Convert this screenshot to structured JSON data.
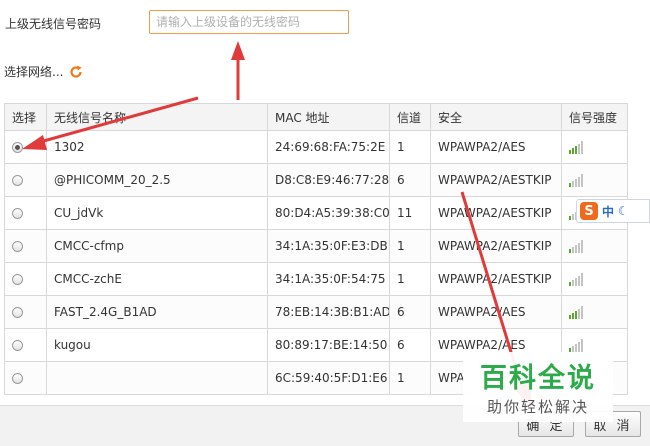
{
  "password": {
    "label": "上级无线信号密码",
    "placeholder": "请输入上级设备的无线密码",
    "value": ""
  },
  "select_network": {
    "label": "选择网络...",
    "refresh_icon": "refresh-icon"
  },
  "table": {
    "columns": [
      "选择",
      "无线信号名称",
      "MAC 地址",
      "信道",
      "安全",
      "信号强度"
    ],
    "rows": [
      {
        "selected": true,
        "ssid": "1302",
        "mac": "24:69:68:FA:75:2E",
        "channel": "1",
        "security": "WPAWPA2/AES",
        "signal_bars": 3
      },
      {
        "selected": false,
        "ssid": "@PHICOMM_20_2.5",
        "mac": "D8:C8:E9:46:77:28",
        "channel": "6",
        "security": "WPAWPA2/AESTKIP",
        "signal_bars": 1
      },
      {
        "selected": false,
        "ssid": "CU_jdVk",
        "mac": "80:D4:A5:39:38:C0",
        "channel": "11",
        "security": "WPAWPA2/AESTKIP",
        "signal_bars": 1
      },
      {
        "selected": false,
        "ssid": "CMCC-cfmp",
        "mac": "34:1A:35:0F:E3:DB",
        "channel": "1",
        "security": "WPAWPA2/AESTKIP",
        "signal_bars": 1
      },
      {
        "selected": false,
        "ssid": "CMCC-zchE",
        "mac": "34:1A:35:0F:54:75",
        "channel": "1",
        "security": "WPAWPA2/AESTKIP",
        "signal_bars": 1
      },
      {
        "selected": false,
        "ssid": "FAST_2.4G_B1AD",
        "mac": "78:EB:14:3B:B1:AD",
        "channel": "6",
        "security": "WPAWPA2/AES",
        "signal_bars": 3
      },
      {
        "selected": false,
        "ssid": "kugou",
        "mac": "80:89:17:BE:14:50",
        "channel": "6",
        "security": "WPAWPA2/AES",
        "signal_bars": 1
      },
      {
        "selected": false,
        "ssid": "",
        "mac": "6C:59:40:5F:D1:E6",
        "channel": "1",
        "security": "WPA",
        "signal_bars": 1
      }
    ]
  },
  "buttons": {
    "ok": "确 定",
    "cancel": "取 消"
  },
  "ime": {
    "logo": "S",
    "mode": "中",
    "icon": "moon-icon"
  },
  "watermark": {
    "title": "百科全说",
    "subtitle": "助你轻松解决"
  },
  "colors": {
    "accent_orange": "#f09a4c",
    "signal_filled": "#5aa82e",
    "arrow_red": "#e03a3a",
    "watermark_green": "#2daa4a"
  }
}
